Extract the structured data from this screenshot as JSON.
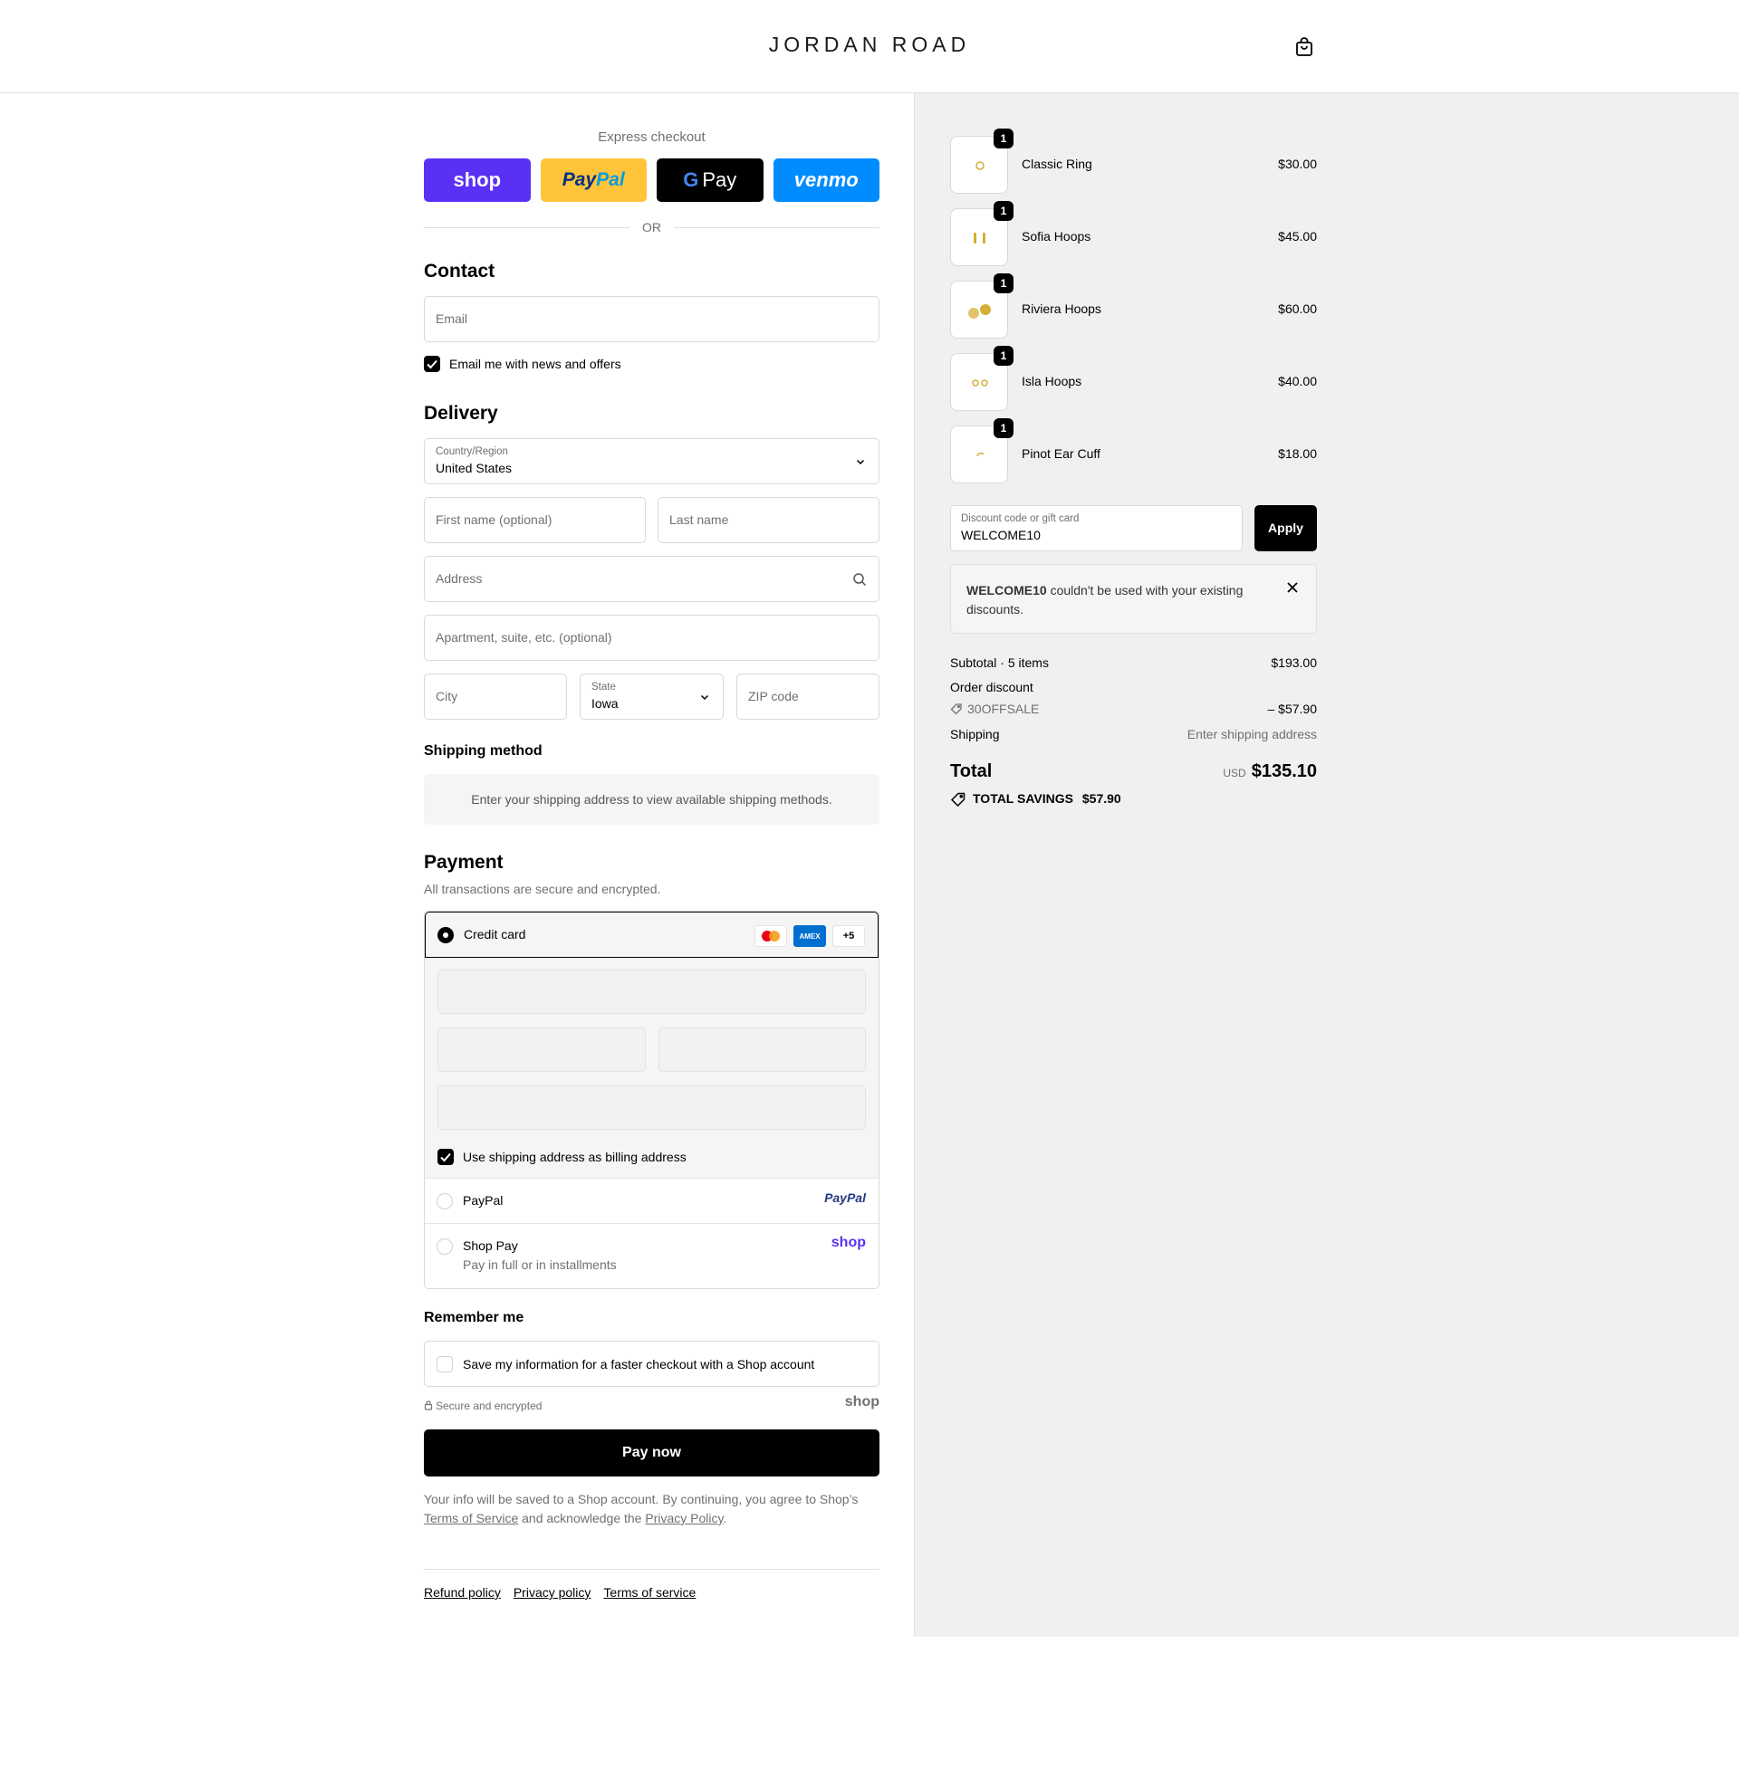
{
  "header": {
    "logo": "JORDAN ROAD"
  },
  "express": {
    "label": "Express checkout",
    "buttons": {
      "shop": "shop",
      "paypal": "PayPal",
      "gpay": "Pay",
      "venmo": "venmo"
    },
    "or": "OR"
  },
  "contact": {
    "title": "Contact",
    "email_placeholder": "Email",
    "news_label": "Email me with news and offers"
  },
  "delivery": {
    "title": "Delivery",
    "country_label": "Country/Region",
    "country_value": "United States",
    "first_name_placeholder": "First name (optional)",
    "last_name_placeholder": "Last name",
    "address_placeholder": "Address",
    "apartment_placeholder": "Apartment, suite, etc. (optional)",
    "city_placeholder": "City",
    "state_label": "State",
    "state_value": "Iowa",
    "zip_placeholder": "ZIP code"
  },
  "shipping": {
    "title": "Shipping method",
    "note": "Enter your shipping address to view available shipping methods."
  },
  "payment": {
    "title": "Payment",
    "subtitle": "All transactions are secure and encrypted.",
    "credit_card_label": "Credit card",
    "more_cards": "+5",
    "billing_label": "Use shipping address as billing address",
    "paypal_label": "PayPal",
    "paypal_logo": "PayPal",
    "shoppay_label": "Shop Pay",
    "shoppay_sub": "Pay in full or in installments",
    "shoppay_logo": "shop"
  },
  "remember": {
    "title": "Remember me",
    "save_label": "Save my information for a faster checkout with a Shop account",
    "secure": "Secure and encrypted",
    "shop_logo": "shop"
  },
  "pay_now": "Pay now",
  "legal": {
    "text1": "Your info will be saved to a Shop account. By continuing, you agree to Shop’s ",
    "tos": "Terms of Service",
    "text2": " and acknowledge the ",
    "privacy": "Privacy Policy",
    "text3": "."
  },
  "footer": {
    "refund": "Refund policy",
    "privacy": "Privacy policy",
    "terms": "Terms of service"
  },
  "summary": {
    "items": [
      {
        "name": "Classic Ring",
        "price": "$30.00",
        "qty": "1"
      },
      {
        "name": "Sofia Hoops",
        "price": "$45.00",
        "qty": "1"
      },
      {
        "name": "Riviera Hoops",
        "price": "$60.00",
        "qty": "1"
      },
      {
        "name": "Isla Hoops",
        "price": "$40.00",
        "qty": "1"
      },
      {
        "name": "Pinot Ear Cuff",
        "price": "$18.00",
        "qty": "1"
      }
    ],
    "discount_label": "Discount code or gift card",
    "discount_value": "WELCOME10",
    "apply": "Apply",
    "error_code": "WELCOME10",
    "error_msg": " couldn't be used with your existing discounts.",
    "subtotal_label": "Subtotal · 5 items",
    "subtotal_value": "$193.00",
    "order_discount_label": "Order discount",
    "discount_code": "30OFFSALE",
    "discount_amount": "– $57.90",
    "shipping_label": "Shipping",
    "shipping_value": "Enter shipping address",
    "total_label": "Total",
    "currency": "USD",
    "total_value": "$135.10",
    "savings_label": "TOTAL SAVINGS",
    "savings_value": "$57.90"
  },
  "colors": {
    "shop_purple": "#5a31f4",
    "paypal_yellow": "#ffc439",
    "venmo_blue": "#008cff",
    "panel_bg": "#f0f0f0"
  }
}
